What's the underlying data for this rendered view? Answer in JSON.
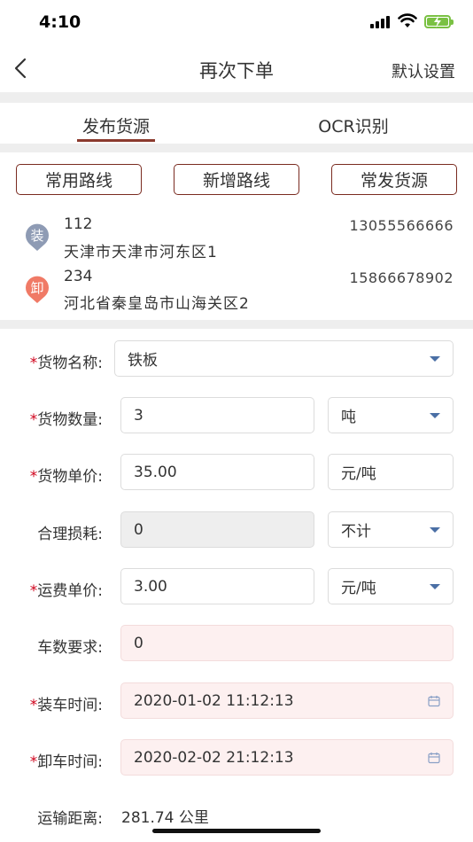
{
  "status": {
    "time": "4:10"
  },
  "nav": {
    "title": "再次下单",
    "right_label": "默认设置"
  },
  "tabs": [
    {
      "label": "发布货源"
    },
    {
      "label": "OCR识别"
    }
  ],
  "buttons": [
    {
      "label": "常用路线"
    },
    {
      "label": "新增路线"
    },
    {
      "label": "常发货源"
    }
  ],
  "loading": {
    "icon_label": "装",
    "name": "112",
    "phone": "13055566666",
    "address": "天津市天津市河东区1"
  },
  "unloading": {
    "icon_label": "卸",
    "name": "234",
    "phone": "15866678902",
    "address": "河北省秦皇岛市山海关区2"
  },
  "form": {
    "cargo_name": {
      "label": "货物名称:",
      "value": "铁板"
    },
    "cargo_qty": {
      "label": "货物数量:",
      "value": "3",
      "unit": "吨"
    },
    "cargo_price": {
      "label": "货物单价:",
      "value": "35.00",
      "unit": "元/吨"
    },
    "loss": {
      "label": "合理损耗:",
      "value": "0",
      "unit": "不计"
    },
    "freight_price": {
      "label": "运费单价:",
      "value": "3.00",
      "unit": "元/吨"
    },
    "truck_count": {
      "label": "车数要求:",
      "value": "0"
    },
    "load_time": {
      "label": "装车时间:",
      "value": "2020-01-02 11:12:13"
    },
    "unload_time": {
      "label": "卸车时间:",
      "value": "2020-02-02 21:12:13"
    },
    "distance": {
      "label": "运输距离:",
      "value": "281.74 公里"
    }
  },
  "colors": {
    "accent": "#8b3a2e",
    "load_icon": "#8e9bb4",
    "unload_icon": "#f07a66",
    "required": "#d0021b"
  }
}
